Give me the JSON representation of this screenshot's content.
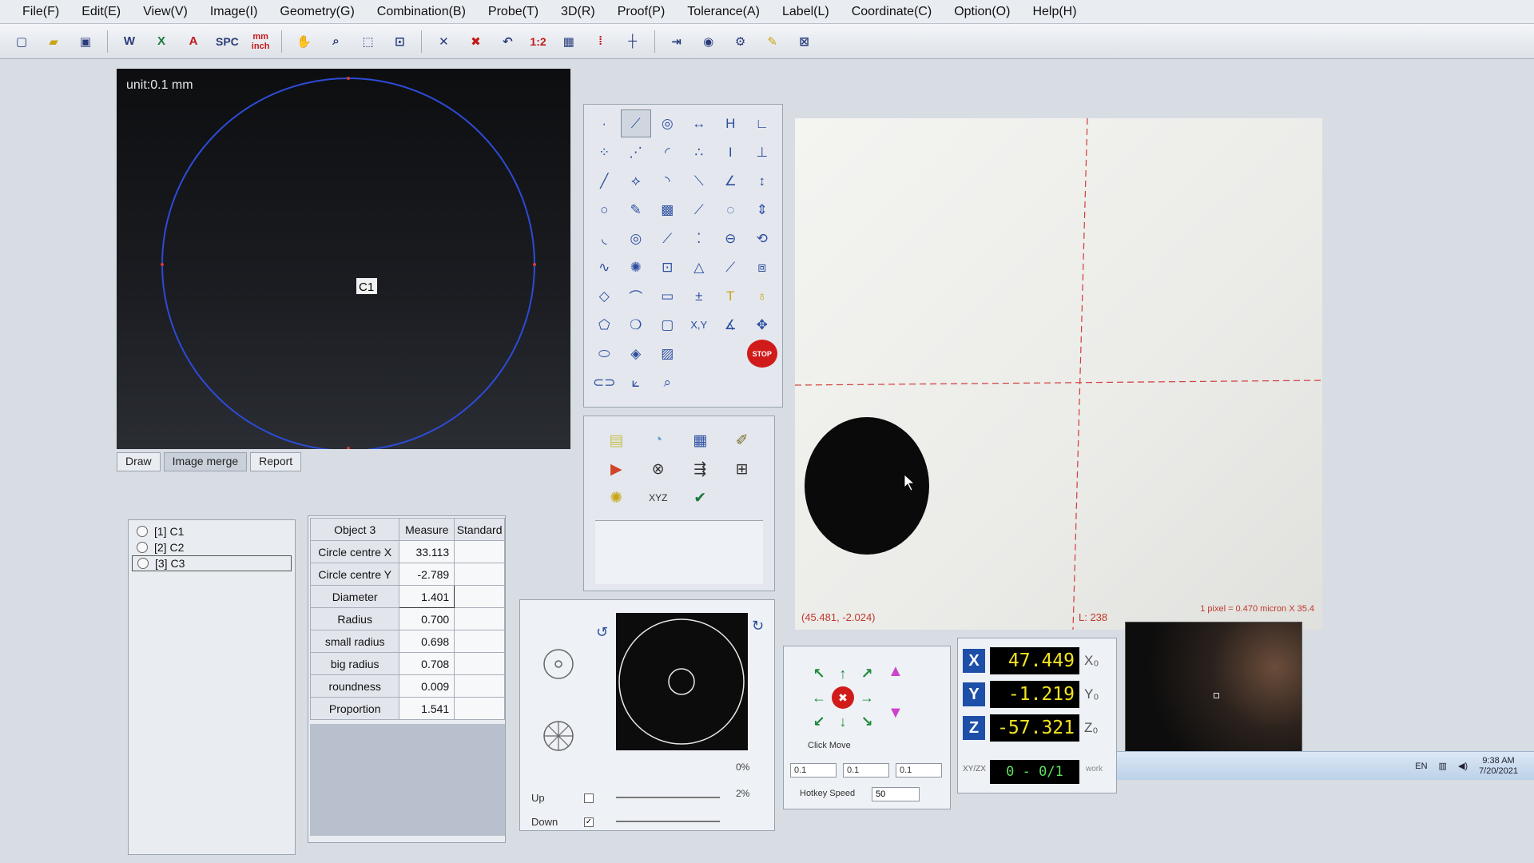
{
  "menu": [
    "File(F)",
    "Edit(E)",
    "View(V)",
    "Image(I)",
    "Geometry(G)",
    "Combination(B)",
    "Probe(T)",
    "3D(R)",
    "Proof(P)",
    "Tolerance(A)",
    "Label(L)",
    "Coordinate(C)",
    "Option(O)",
    "Help(H)"
  ],
  "toolbar": {
    "spc_label": "SPC",
    "mm_label": "mm",
    "inch_label": "inch",
    "ratio_label": "1:2",
    "icons": [
      "new-file-icon",
      "open-folder-icon",
      "save-icon",
      "word-export-icon",
      "excel-export-icon",
      "pdf-export-icon",
      "hand-pan-icon",
      "zoom-icon",
      "select-box-icon",
      "zoom-window-icon",
      "delete-icon",
      "undo-icon",
      "grid-icon",
      "crosshair-icon",
      "export-icon",
      "camera-icon",
      "settings-icon"
    ]
  },
  "draw_panel": {
    "unit_label": "unit:0.1 mm",
    "circle_label": "C1",
    "tabs": [
      "Draw",
      "Image merge",
      "Report"
    ],
    "active_tab": "Image merge"
  },
  "objects": [
    {
      "label": "[1] C1"
    },
    {
      "label": "[2] C2"
    },
    {
      "label": "[3] C3",
      "selected": true
    }
  ],
  "measure_table": {
    "headers": [
      "Object 3",
      "Measure",
      "Standard"
    ],
    "rows": [
      {
        "name": "Circle centre X",
        "measure": "33.113",
        "standard": ""
      },
      {
        "name": "Circle centre Y",
        "measure": "-2.789",
        "standard": ""
      },
      {
        "name": "Diameter",
        "measure": "1.401",
        "standard": ""
      },
      {
        "name": "Radius",
        "measure": "0.700",
        "standard": ""
      },
      {
        "name": "small radius",
        "measure": "0.698",
        "standard": ""
      },
      {
        "name": "big radius",
        "measure": "0.708",
        "standard": ""
      },
      {
        "name": "roundness",
        "measure": "0.009",
        "standard": ""
      },
      {
        "name": "Proportion",
        "measure": "1.541",
        "standard": ""
      }
    ]
  },
  "circle_tool": {
    "up_label": "Up",
    "down_label": "Down",
    "up_pct": "0%",
    "down_pct": "2%",
    "down_checked": true
  },
  "camera": {
    "coords": "(45.481, -2.024)",
    "l_value": "L: 238",
    "pixel_info": "1 pixel = 0.470 micron  X 35.4"
  },
  "jog": {
    "click_move_label": "Click Move",
    "steps": [
      "0.1",
      "0.1",
      "0.1"
    ],
    "hotkey_label": "Hotkey Speed",
    "hotkey_value": "50"
  },
  "dro": {
    "x": "47.449",
    "y": "-1.219",
    "z": "-57.321",
    "ratio": "0 - 0/1",
    "x_axis": "X",
    "y_axis": "Y",
    "z_axis": "Z",
    "x_zero": "X₀",
    "y_zero": "Y₀",
    "z_zero": "Z₀",
    "small_label": "XY/ZX",
    "work_label": "work"
  },
  "taskbar": {
    "lang": "EN",
    "time": "9:38 AM",
    "date": "7/20/2021"
  },
  "colors": {
    "dro_text": "#f2e320",
    "axis_button": "#1d4fa8",
    "draw_circle": "#2d4bd6",
    "crosshair": "#d23b3b"
  }
}
